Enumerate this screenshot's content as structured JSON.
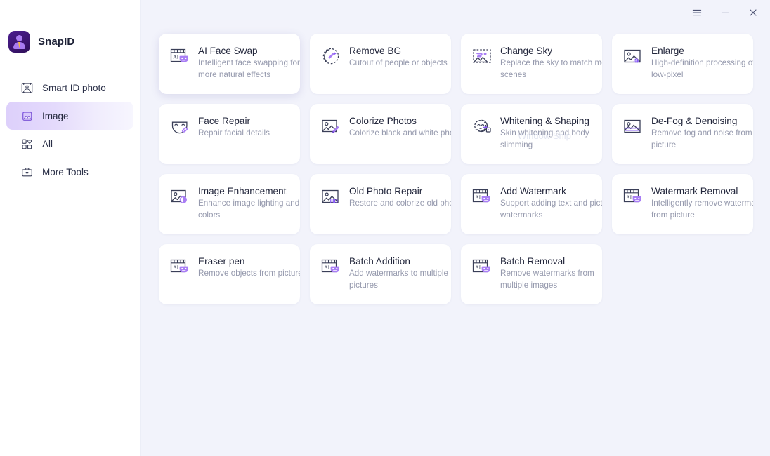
{
  "app": {
    "name": "SnapID",
    "logo_icon": "person-id-logo",
    "accent_color": "#8a5cf6",
    "background_color": "#f2f3fb",
    "card_color": "#ffffff"
  },
  "titlebar": {
    "buttons": [
      {
        "name": "menu-button",
        "icon": "hamburger-icon",
        "glyph": "☰"
      },
      {
        "name": "minimize-button",
        "icon": "minimize-icon",
        "glyph": "–"
      },
      {
        "name": "close-button",
        "icon": "close-icon",
        "glyph": "✕"
      }
    ]
  },
  "sidebar": {
    "items": [
      {
        "label": "Smart ID photo",
        "icon": "id-photo-icon",
        "active": false
      },
      {
        "label": "Image",
        "icon": "image-icon",
        "active": true
      },
      {
        "label": "All",
        "icon": "grid-heart-icon",
        "active": false
      },
      {
        "label": "More Tools",
        "icon": "briefcase-icon",
        "active": false
      }
    ]
  },
  "main": {
    "cards": [
      {
        "title": "AI Face Swap",
        "desc": "Intelligent face swapping for more natural effects",
        "icon": "ai-mask-icon",
        "hovered": true
      },
      {
        "title": "Remove BG",
        "desc": "Cutout of people or objects",
        "icon": "magic-wand-circle-icon",
        "hovered": false
      },
      {
        "title": "Change Sky",
        "desc": "Replace the sky to match more scenes",
        "icon": "sky-image-icon",
        "hovered": false
      },
      {
        "title": "Enlarge",
        "desc": "High-definition processing of low-pixel",
        "icon": "image-4k-icon",
        "hovered": false
      },
      {
        "title": "Face Repair",
        "desc": "Repair facial details",
        "icon": "face-mask-repair-icon",
        "hovered": false
      },
      {
        "title": "Colorize Photos",
        "desc": "Colorize black and white photos",
        "icon": "image-brush-icon",
        "hovered": false
      },
      {
        "title": "Whitening & Shaping",
        "desc": "Skin whitening and body slimming",
        "icon": "face-shaping-icon",
        "hovered": false
      },
      {
        "title": "De-Fog & Denoising",
        "desc": "Remove fog and noise from picture",
        "icon": "image-fog-icon",
        "hovered": false
      },
      {
        "title": "Image Enhancement",
        "desc": "Enhance image lighting and colors",
        "icon": "image-contrast-icon",
        "hovered": false
      },
      {
        "title": "Old Photo Repair",
        "desc": "Restore and colorize old photos",
        "icon": "image-hd-icon",
        "hovered": false
      },
      {
        "title": "Add Watermark",
        "desc": "Support adding text and picture watermarks",
        "icon": "ai-mask-icon",
        "hovered": false
      },
      {
        "title": "Watermark Removal",
        "desc": "Intelligently remove watermark from picture",
        "icon": "ai-mask-icon",
        "hovered": false
      },
      {
        "title": "Eraser pen",
        "desc": "Remove objects from picture",
        "icon": "ai-mask-icon",
        "hovered": false
      },
      {
        "title": "Batch Addition",
        "desc": "Add watermarks to multiple pictures",
        "icon": "ai-mask-icon",
        "hovered": false
      },
      {
        "title": "Batch Removal",
        "desc": "Remove watermarks from multiple images",
        "icon": "ai-mask-icon",
        "hovered": false
      }
    ]
  },
  "artifact": {
    "text": "Window Snip"
  }
}
